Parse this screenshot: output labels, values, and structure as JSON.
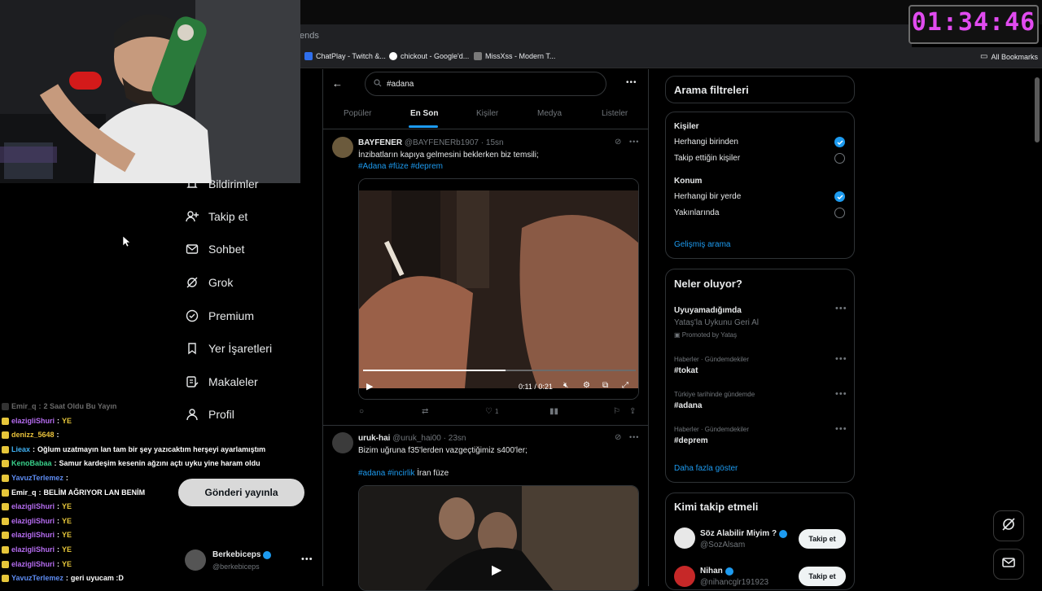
{
  "timer": "01:34:46",
  "browser": {
    "address_fragment": "ends",
    "bookmarks": [
      {
        "label": "ChatPlay - Twitch &...",
        "icon": "chatplay-icon"
      },
      {
        "label": "chickout - Google'd...",
        "icon": "google-icon"
      },
      {
        "label": "MissXss - Modern T...",
        "icon": "bookmark-site-icon"
      }
    ],
    "all_bookmarks": "All Bookmarks"
  },
  "nav": {
    "items": [
      {
        "label": "Bildirimler",
        "icon": "bell-icon"
      },
      {
        "label": "Takip et",
        "icon": "add-user-icon"
      },
      {
        "label": "Sohbet",
        "icon": "mail-icon"
      },
      {
        "label": "Grok",
        "icon": "grok-icon"
      },
      {
        "label": "Premium",
        "icon": "premium-icon"
      },
      {
        "label": "Yer İşaretleri",
        "icon": "bookmark-icon"
      },
      {
        "label": "Makaleler",
        "icon": "article-icon"
      },
      {
        "label": "Profil",
        "icon": "person-icon"
      }
    ],
    "post_button": "Gönderi yayınla",
    "profile": {
      "name": "Berkebiceps",
      "handle": "@berkebiceps"
    }
  },
  "chat": [
    {
      "user": "Emir_q",
      "message": "2 Saat Oldu Bu Yayın",
      "color": "#6a6a6a"
    },
    {
      "user": "elazigliShuri",
      "message": "YE",
      "color": "#b56cf0"
    },
    {
      "user": "denizz_5648",
      "message": "",
      "color": "#e9c23b"
    },
    {
      "user": "Lieax",
      "message": "Oğlum uzatmayın lan tam bir şey yazıcaktım herşeyi ayarlamıştım",
      "color": "#3fb0f2"
    },
    {
      "user": "KenoBabaa",
      "message": "Samur kardeşim kesenin ağzını açtı uyku yine haram oldu",
      "color": "#39d18b"
    },
    {
      "user": "YavuzTerlemez",
      "message": "",
      "color": "#5e8cf2"
    },
    {
      "user": "Emir_q",
      "message": "BELİM AĞRIYOR LAN BENİM",
      "color": "#ffffff"
    },
    {
      "user": "elazigliShuri",
      "message": "YE",
      "color": "#b56cf0"
    },
    {
      "user": "elazigliShuri",
      "message": "YE",
      "color": "#b56cf0"
    },
    {
      "user": "elazigliShuri",
      "message": "YE",
      "color": "#b56cf0"
    },
    {
      "user": "elazigliShuri",
      "message": "YE",
      "color": "#b56cf0"
    },
    {
      "user": "elazigliShuri",
      "message": "YE",
      "color": "#b56cf0"
    },
    {
      "user": "YavuzTerlemez",
      "message": "geri uyucam :D",
      "color": "#5e8cf2"
    }
  ],
  "search": {
    "query": "#adana"
  },
  "tabs": [
    "Popüler",
    "En Son",
    "Kişiler",
    "Medya",
    "Listeler"
  ],
  "active_tab": "En Son",
  "tweets": [
    {
      "name": "BAYFENER",
      "handle": "@BAYFENERb1907 · 15sn",
      "text": "İnzibatların kapıya gelmesini beklerken biz temsili;",
      "tags_line": "#Adana #füze #deprem",
      "video_time": "0:11 / 0:21",
      "likes": "1"
    },
    {
      "name": "uruk-hai",
      "handle": "@uruk_hai00 · 23sn",
      "text": "Bizim uğruna f35'lerden vazgeçtiğimiz s400'ler;",
      "tags_line_tags": "#adana #incirlik",
      "tags_line_rest": " İran füze"
    }
  ],
  "filters": {
    "title": "Arama filtreleri",
    "people_title": "Kişiler",
    "people_options": [
      "Herhangi birinden",
      "Takip ettiğin kişiler"
    ],
    "location_title": "Konum",
    "location_options": [
      "Herhangi bir yerde",
      "Yakınlarında"
    ],
    "advanced": "Gelişmiş arama"
  },
  "trends": {
    "title": "Neler oluyor?",
    "items": [
      {
        "context": "",
        "name": "Uyuyamadığımda",
        "sub": "Yataş'la Uykunu Geri Al",
        "promoted": "Promoted by Yataş"
      },
      {
        "context": "Haberler · Gündemdekiler",
        "name": "#tokat"
      },
      {
        "context": "Türkiye tarihinde gündemde",
        "name": "#adana"
      },
      {
        "context": "Haberler · Gündemdekiler",
        "name": "#deprem"
      }
    ],
    "more": "Daha fazla göster"
  },
  "who_to_follow": {
    "title": "Kimi takip etmeli",
    "users": [
      {
        "name": "Söz Alabilir Miyim ?",
        "handle": "@SozAlsam",
        "button": "Takip et"
      },
      {
        "name": "Nihan",
        "handle": "@nihancglr191923",
        "button": "Takip et"
      }
    ]
  },
  "colors": {
    "accent": "#1d9bf0",
    "timer": "#e14bf0"
  }
}
